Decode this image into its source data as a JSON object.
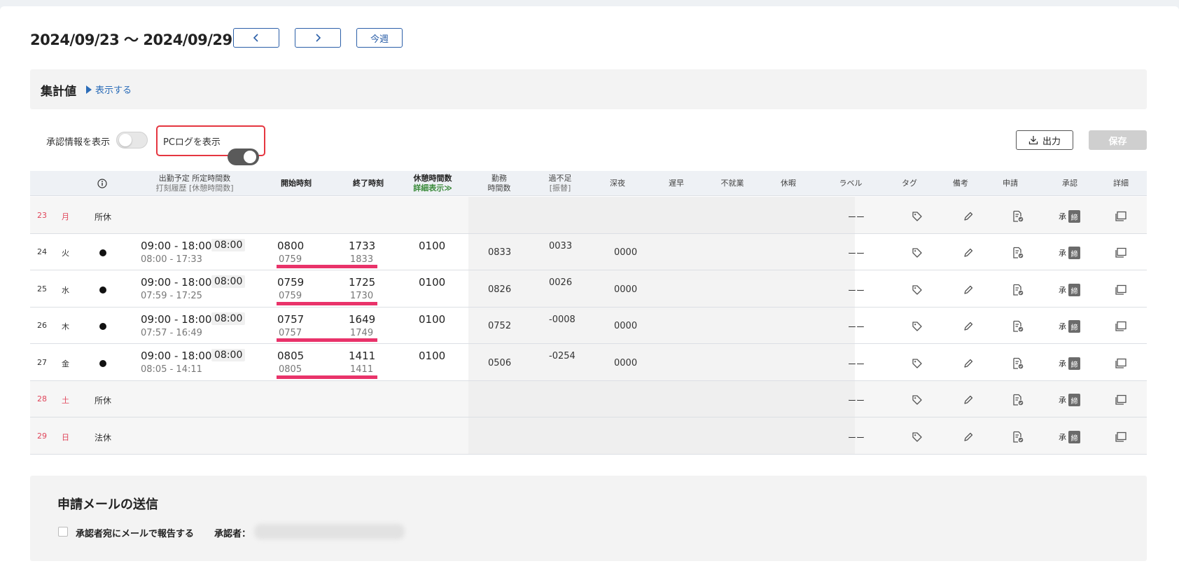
{
  "header": {
    "week_range": "2024/09/23 〜 2024/09/29",
    "this_week_label": "今週"
  },
  "summary": {
    "title": "集計値",
    "show_link": "表示する"
  },
  "toggles": {
    "approval_info_label": "承認情報を表示",
    "approval_info_on": false,
    "pc_log_label": "PCログを表示",
    "pc_log_on": true
  },
  "actions": {
    "export_label": "出力",
    "save_label": "保存"
  },
  "table": {
    "headers": {
      "scheduled_top": "出勤予定  所定時間数",
      "scheduled_bottom": "打刻履歴  [休憩時間数]",
      "start": "開始時刻",
      "end": "終了時刻",
      "break_top": "休憩時間数",
      "break_link": "詳細表示≫",
      "work_top": "勤務",
      "work_bottom": "時間数",
      "over_top": "過不足",
      "over_bottom": "[振替]",
      "night": "深夜",
      "late": "遅早",
      "nonwork": "不就業",
      "leave": "休暇",
      "label": "ラベル",
      "tag": "タグ",
      "note": "備考",
      "request": "申請",
      "approve": "承認",
      "detail": "詳細"
    },
    "rows": [
      {
        "day": "23",
        "dow": "月",
        "holiday": true,
        "status": "所休",
        "label": "ーー",
        "approve_char": "承",
        "lock_char": "締"
      },
      {
        "day": "24",
        "dow": "火",
        "holiday": false,
        "schedule": "09:00 - 18:00",
        "hours": "08:00",
        "punch": "08:00  - 17:33",
        "start": "0800",
        "start_log": "0759",
        "end": "1733",
        "end_log": "1833",
        "break": "0100",
        "work": "0833",
        "over": "0033",
        "night": "0000",
        "label": "ーー",
        "approve_char": "承",
        "lock_char": "締"
      },
      {
        "day": "25",
        "dow": "水",
        "holiday": false,
        "schedule": "09:00 - 18:00",
        "hours": "08:00",
        "punch": "07:59  - 17:25",
        "start": "0759",
        "start_log": "0759",
        "end": "1725",
        "end_log": "1730",
        "break": "0100",
        "work": "0826",
        "over": "0026",
        "night": "0000",
        "label": "ーー",
        "approve_char": "承",
        "lock_char": "締"
      },
      {
        "day": "26",
        "dow": "木",
        "holiday": false,
        "schedule": "09:00 - 18:00",
        "hours": "08:00",
        "punch": "07:57  - 16:49",
        "start": "0757",
        "start_log": "0757",
        "end": "1649",
        "end_log": "1749",
        "break": "0100",
        "work": "0752",
        "over": "-0008",
        "night": "0000",
        "label": "ーー",
        "approve_char": "承",
        "lock_char": "締"
      },
      {
        "day": "27",
        "dow": "金",
        "holiday": false,
        "schedule": "09:00 - 18:00",
        "hours": "08:00",
        "punch": "08:05  - 14:11",
        "start": "0805",
        "start_log": "0805",
        "end": "1411",
        "end_log": "1411",
        "break": "0100",
        "work": "0506",
        "over": "-0254",
        "night": "0000",
        "label": "ーー",
        "approve_char": "承",
        "lock_char": "締"
      },
      {
        "day": "28",
        "dow": "土",
        "holiday": true,
        "status": "所休",
        "label": "ーー",
        "approve_char": "承",
        "lock_char": "締"
      },
      {
        "day": "29",
        "dow": "日",
        "holiday": true,
        "status": "法休",
        "label": "ーー",
        "approve_char": "承",
        "lock_char": "締"
      }
    ]
  },
  "mail": {
    "title": "申請メールの送信",
    "checkbox_label": "承認者宛にメールで報告する",
    "approver_label": "承認者："
  },
  "colors": {
    "accent": "#2b5fa8",
    "holiday_red": "#e0455a",
    "log_underline": "#e9336a",
    "highlight_border": "#e53640"
  }
}
